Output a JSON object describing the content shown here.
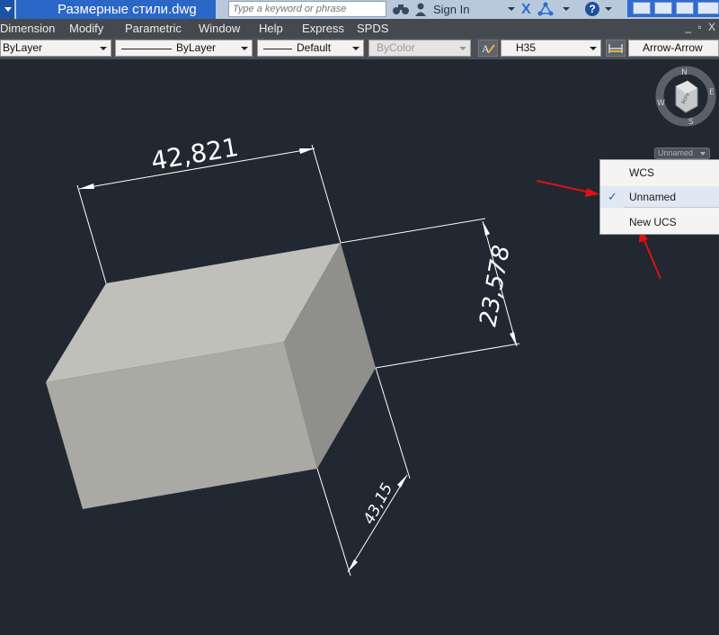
{
  "titlebar": {
    "doc_title": "Размерные стили.dwg",
    "search_placeholder": "Type a keyword or phrase",
    "signin_label": "Sign In",
    "help_label": "?"
  },
  "menu": {
    "items": [
      "Dimension",
      "Modify",
      "Parametric",
      "Window",
      "Help",
      "Express",
      "SPDS"
    ],
    "mdi_buttons": "_ ▫ X"
  },
  "properties": {
    "color": "ByLayer",
    "linetype": "ByLayer",
    "lineweight": "Default",
    "plotstyle": "ByColor",
    "text_style": "H35",
    "dim_style": "Arrow-Arrow"
  },
  "drawing": {
    "dim_width": "42,821",
    "dim_height": "23,578",
    "dim_depth": "43,15"
  },
  "viewcube": {
    "north": "N",
    "south": "S",
    "east": "E",
    "west": "W",
    "face": "ВЕРХ"
  },
  "ucs": {
    "button_label": "Unnamed",
    "menu_items": [
      {
        "label": "WCS",
        "checked": false
      },
      {
        "label": "Unnamed",
        "checked": true
      },
      {
        "label": "New UCS",
        "checked": false
      }
    ],
    "check_glyph": "✓"
  },
  "colors": {
    "canvas_bg": "#222831",
    "annotation_arrow": "#e01010",
    "box_front": "#a9aaa4",
    "box_top": "#bfc0ba",
    "box_side": "#8f908b"
  }
}
